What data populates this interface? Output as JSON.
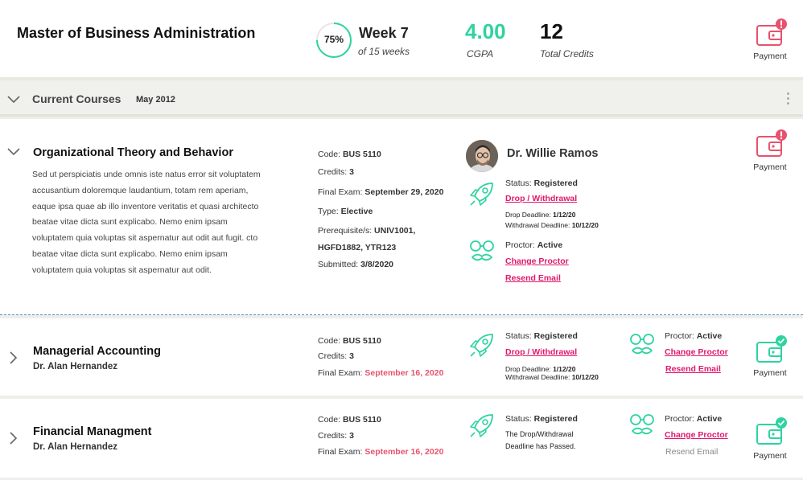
{
  "header": {
    "program_title": "Master of Business Administration",
    "progress_percent": "75%",
    "progress_fraction": 0.75,
    "week_label": "Week 7",
    "week_sub": "of 15 weeks",
    "cgpa_value": "4.00",
    "cgpa_label": "CGPA",
    "credits_value": "12",
    "credits_label": "Total Credits",
    "payment_label": "Payment"
  },
  "section": {
    "title": "Current Courses",
    "term": "May 2012"
  },
  "courses": [
    {
      "title": "Organizational Theory and Behavior",
      "description": "Sed ut perspiciatis unde omnis iste natus error sit voluptatem accusantium doloremque laudantium, totam rem aperiam, eaque ipsa quae ab illo inventore veritatis et quasi architecto beatae vitae dicta sunt explicabo. Nemo enim ipsam voluptatem quia voluptas sit aspernatur aut odit aut fugit. cto beatae vitae dicta sunt explicabo. Nemo enim ipsam voluptatem quia voluptas sit aspernatur aut odit.",
      "code_label": "Code:",
      "code": "BUS 5110",
      "credits_label": "Credits:",
      "credits": "3",
      "exam_label": "Final Exam:",
      "exam": "September 29, 2020",
      "type_label": "Type:",
      "type": "Elective",
      "prereq_label": "Prerequisite/s:",
      "prereq_1": "UNIV1001,",
      "prereq_2": "HGFD1882, YTR123",
      "submitted_label": "Submitted:",
      "submitted": "3/8/2020",
      "instructor": "Dr. Willie Ramos",
      "status_label": "Status:",
      "status": "Registered",
      "drop_link": "Drop / Withdrawal",
      "drop_deadline_label": "Drop Deadline:",
      "drop_deadline": "1/12/20",
      "withdraw_deadline_label": "Withdrawal  Deadline:",
      "withdraw_deadline": "10/12/20",
      "proctor_label": "Proctor:",
      "proctor": "Active",
      "change_proctor": "Change Proctor",
      "resend_email": "Resend Email",
      "payment_label": "Payment"
    },
    {
      "title": "Managerial Accounting",
      "instructor": "Dr. Alan Hernandez",
      "code_label": "Code:",
      "code": "BUS 5110",
      "credits_label": "Credits:",
      "credits": "3",
      "exam_label": "Final Exam:",
      "exam": "September 16, 2020",
      "status_label": "Status:",
      "status": "Registered",
      "drop_link": "Drop / Withdrawal",
      "drop_deadline_label": "Drop Deadline:",
      "drop_deadline": "1/12/20",
      "withdraw_deadline_label": "Withdrawal  Deadline:",
      "withdraw_deadline": "10/12/20",
      "proctor_label": "Proctor:",
      "proctor": "Active",
      "change_proctor": "Change Proctor",
      "resend_email": "Resend Email",
      "payment_label": "Payment"
    },
    {
      "title": "Financial Managment",
      "instructor": "Dr. Alan Hernandez",
      "code_label": "Code:",
      "code": "BUS 5110",
      "credits_label": "Credits:",
      "credits": "3",
      "exam_label": "Final Exam:",
      "exam": "September 16, 2020",
      "status_label": "Status:",
      "status": "Registered",
      "deadline_note_1": "The Drop/Withdrawal",
      "deadline_note_2": "Deadline has Passed.",
      "proctor_label": "Proctor:",
      "proctor": "Active",
      "change_proctor": "Change Proctor",
      "resend_email": "Resend Email",
      "payment_label": "Payment"
    }
  ],
  "icons": {
    "wallet_alert": "wallet-alert-icon",
    "wallet_ok": "wallet-check-icon",
    "rocket": "rocket-icon",
    "glasses": "proctor-glasses-icon"
  },
  "colors": {
    "accent_green": "#2ed3a0",
    "alert_red": "#e8526e",
    "link_pink": "#e0186c"
  }
}
